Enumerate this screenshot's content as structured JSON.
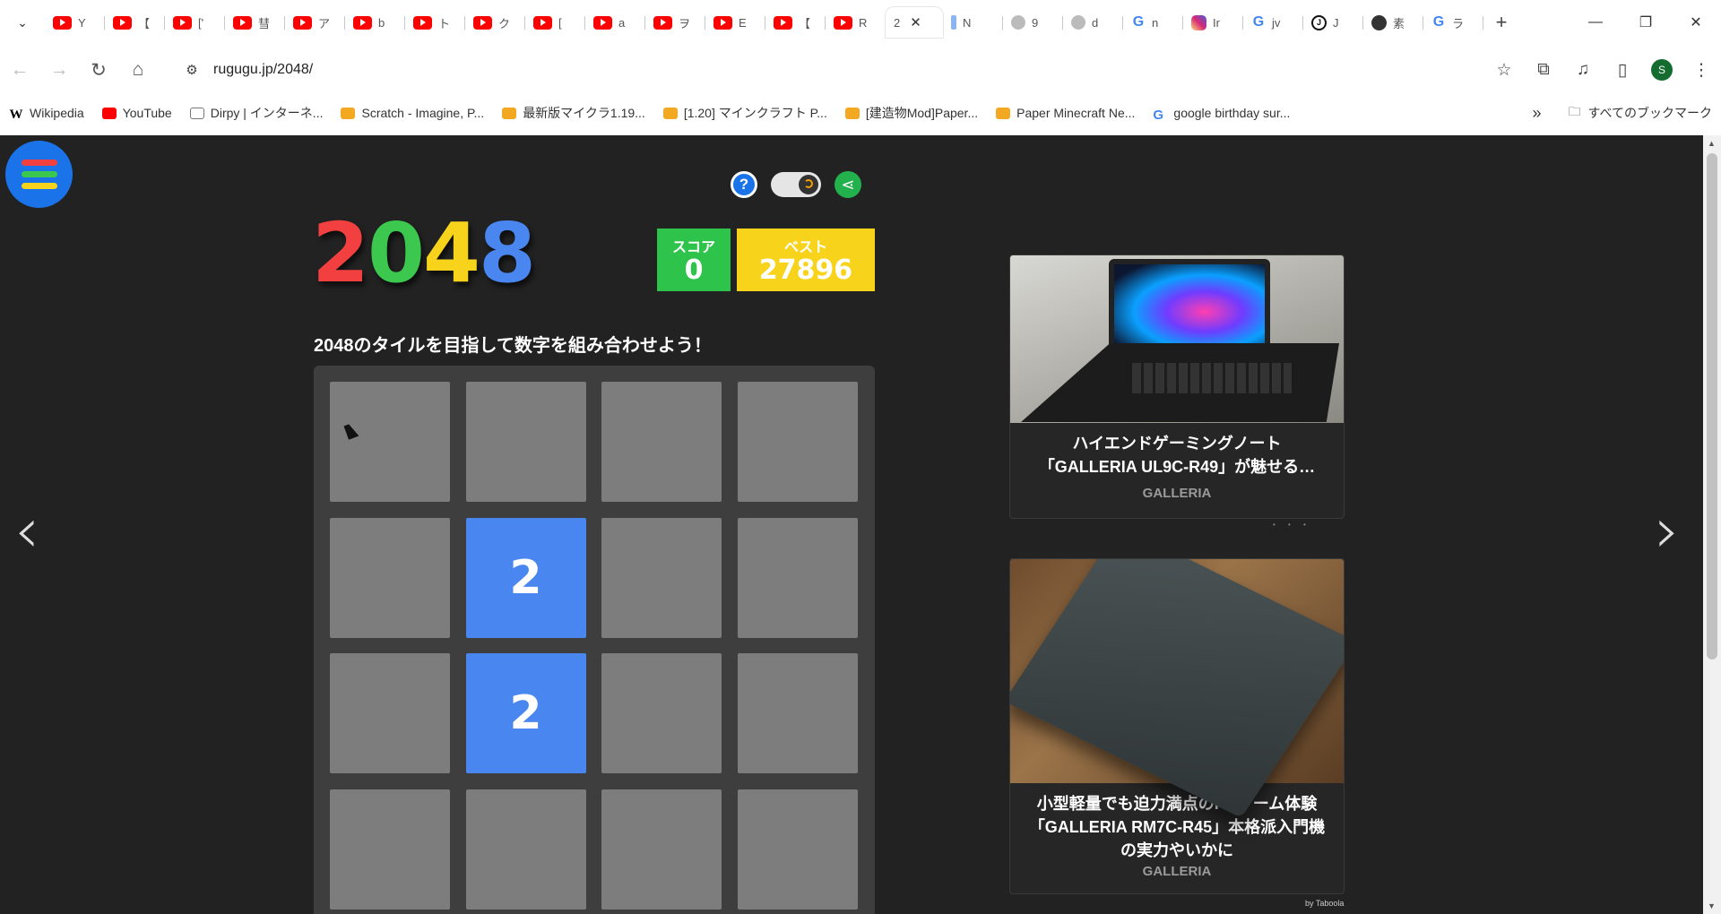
{
  "browser": {
    "tabs": [
      {
        "icon": "youtube-icon",
        "letter": "Y"
      },
      {
        "icon": "youtube-icon",
        "letter": "【"
      },
      {
        "icon": "youtube-icon",
        "letter": "['"
      },
      {
        "icon": "youtube-icon",
        "letter": "彗"
      },
      {
        "icon": "youtube-icon",
        "letter": "ア"
      },
      {
        "icon": "youtube-icon",
        "letter": "b"
      },
      {
        "icon": "youtube-icon",
        "letter": "ト"
      },
      {
        "icon": "youtube-icon",
        "letter": "ク"
      },
      {
        "icon": "youtube-icon",
        "letter": "["
      },
      {
        "icon": "youtube-icon",
        "letter": "a"
      },
      {
        "icon": "youtube-icon",
        "letter": "ヲ"
      },
      {
        "icon": "youtube-icon",
        "letter": "E"
      },
      {
        "icon": "youtube-icon",
        "letter": "【"
      },
      {
        "icon": "youtube-icon",
        "letter": "R"
      },
      {
        "icon": "active",
        "letter": "2"
      },
      {
        "icon": "blue-tab-icon",
        "letter": "N"
      },
      {
        "icon": "globe-icon",
        "letter": "9"
      },
      {
        "icon": "globe-icon",
        "letter": "d"
      },
      {
        "icon": "google-icon",
        "letter": "n"
      },
      {
        "icon": "instagram-icon",
        "letter": "Ir"
      },
      {
        "icon": "google-icon",
        "letter": "jv"
      },
      {
        "icon": "j-icon",
        "letter": "J"
      },
      {
        "icon": "github-icon",
        "letter": "素"
      },
      {
        "icon": "google-icon",
        "letter": "ラ"
      }
    ],
    "url": "rugugu.jp/2048/",
    "avatar_letter": "S",
    "bookmarks": [
      {
        "icon": "w",
        "label": "Wikipedia"
      },
      {
        "icon": "yt",
        "label": "YouTube"
      },
      {
        "icon": "dp",
        "label": "Dirpy | インターネ..."
      },
      {
        "icon": "sc",
        "label": "Scratch - Imagine, P..."
      },
      {
        "icon": "sc",
        "label": "最新版マイクラ1.19..."
      },
      {
        "icon": "sc",
        "label": "[1.20] マインクラフト P..."
      },
      {
        "icon": "sc",
        "label": "[建造物Mod]Paper..."
      },
      {
        "icon": "sc",
        "label": "Paper Minecraft Ne..."
      },
      {
        "icon": "gg",
        "label": "google birthday sur..."
      }
    ],
    "bookmarks_more": "»",
    "all_bookmarks": "すべてのブックマーク"
  },
  "game": {
    "logo": [
      "2",
      "0",
      "4",
      "8"
    ],
    "logo_colors": [
      "#f24040",
      "#3cc74f",
      "#f7d31c",
      "#4a86f0"
    ],
    "score_label": "スコア",
    "score_value": "0",
    "best_label": "ベスト",
    "best_value": "27896",
    "tagline": "2048のタイルを目指して数字を組み合わせよう！",
    "grid": [
      [
        "",
        "",
        "",
        ""
      ],
      [
        "",
        "2",
        "",
        ""
      ],
      [
        "",
        "2",
        "",
        ""
      ],
      [
        "",
        "",
        "",
        ""
      ]
    ],
    "help_glyph": "?",
    "prev_arrow": "‹",
    "next_arrow": "›"
  },
  "ads": [
    {
      "title_line1": "ハイエンドゲーミングノート",
      "title_line2": "「GALLERIA UL9C-R49」が魅せる…",
      "source": "GALLERIA"
    },
    {
      "title_line1": "小型軽量でも迫力満点のPCゲーム体験",
      "title_line2": "「GALLERIA RM7C-R45」本格派入門機",
      "title_line3": "の実力やいかに",
      "source": "GALLERIA"
    }
  ],
  "ads_attribution": "by Taboola",
  "colors": {
    "menu_red": "#f24040",
    "menu_green": "#3cc74f",
    "menu_yellow": "#f7d31c",
    "tile_2": "#4a86f0",
    "empty_cell": "#7d7d7d"
  }
}
